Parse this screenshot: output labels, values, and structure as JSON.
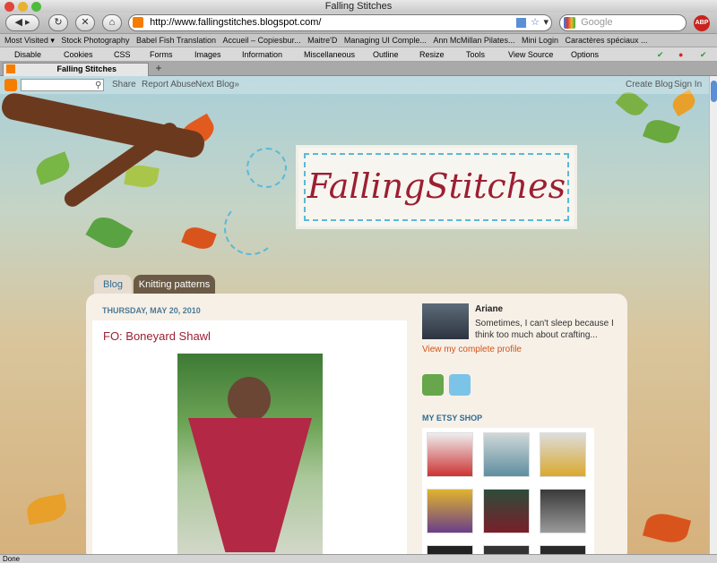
{
  "window": {
    "title": "Falling Stitches"
  },
  "toolbar": {
    "url": "http://www.fallingstitches.blogspot.com/",
    "search_placeholder": "Google",
    "abp_label": "ABP"
  },
  "bookmarks": [
    "Most Visited",
    "Stock Photography",
    "Babel Fish Translation",
    "Accueil – Copiesbur...",
    "Maitre'D",
    "Managing UI Comple...",
    "Ann McMillan Pilates...",
    "Mini Login",
    "Caractères spéciaux ..."
  ],
  "devtools": [
    "Disable",
    "Cookies",
    "CSS",
    "Forms",
    "Images",
    "Information",
    "Miscellaneous",
    "Outline",
    "Resize",
    "Tools",
    "View Source",
    "Options"
  ],
  "tab": {
    "label": "Falling Stitches",
    "new_tab": "+"
  },
  "blogger_nav": {
    "share": "Share",
    "report": "Report Abuse",
    "next": "Next Blog»",
    "create": "Create Blog",
    "signin": "Sign In"
  },
  "blog": {
    "title": "FallingStitches"
  },
  "page_tabs": [
    "Blog",
    "Knitting patterns"
  ],
  "post": {
    "date": "THURSDAY, MAY 20, 2010",
    "title": "FO: Boneyard Shawl"
  },
  "profile": {
    "name": "Ariane",
    "bio": "Sometimes, I can't sleep because I think too much about crafting...",
    "link": "View my complete profile"
  },
  "etsy": {
    "heading": "MY ETSY SHOP"
  },
  "status": {
    "text": "Done"
  },
  "colors": {
    "accent": "#9b1f32",
    "link": "#d4541b",
    "tab_active": "#e6ddd0",
    "tab_inactive": "#6b5a45",
    "date": "#4e7a96"
  }
}
